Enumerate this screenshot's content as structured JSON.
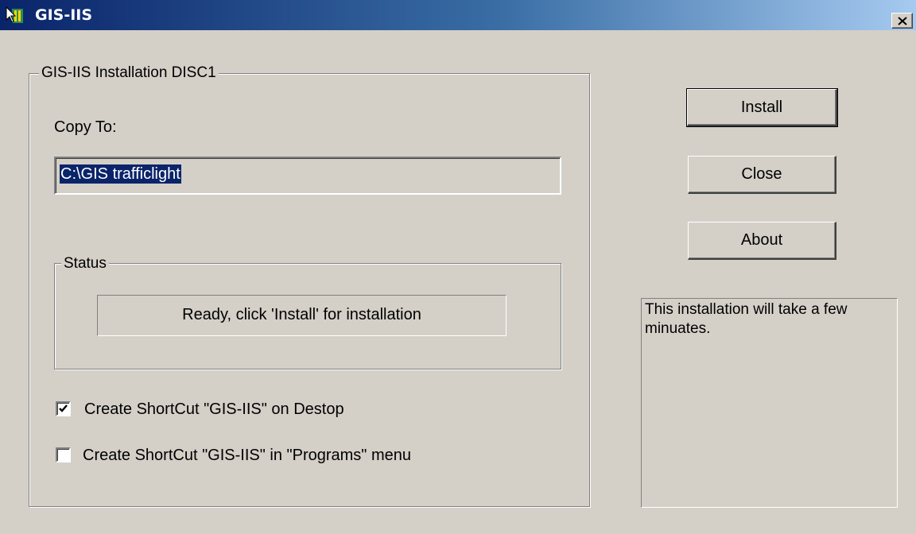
{
  "window": {
    "title": "GIS-IIS",
    "title_gradient": [
      "#0a246a",
      "#a6caf0"
    ],
    "face_color": "#d4d0c8"
  },
  "install_group": {
    "legend": "GIS-IIS Installation DISC1",
    "copy_to_label": "Copy To:",
    "path_value": "C:\\GIS trafficlight"
  },
  "status_group": {
    "legend": "Status",
    "message": "Ready, click 'Install' for installation"
  },
  "options": [
    {
      "label": "Create ShortCut \"GIS-IIS\" on Destop",
      "checked": true
    },
    {
      "label": "Create ShortCut \"GIS-IIS\" in \"Programs\" menu",
      "checked": false
    }
  ],
  "buttons": {
    "install": "Install",
    "close": "Close",
    "about": "About"
  },
  "info_text": "This installation will take a few minuates.",
  "icons": {
    "app": "app-icon",
    "close": "close-x-icon",
    "check": "checkmark-icon"
  }
}
